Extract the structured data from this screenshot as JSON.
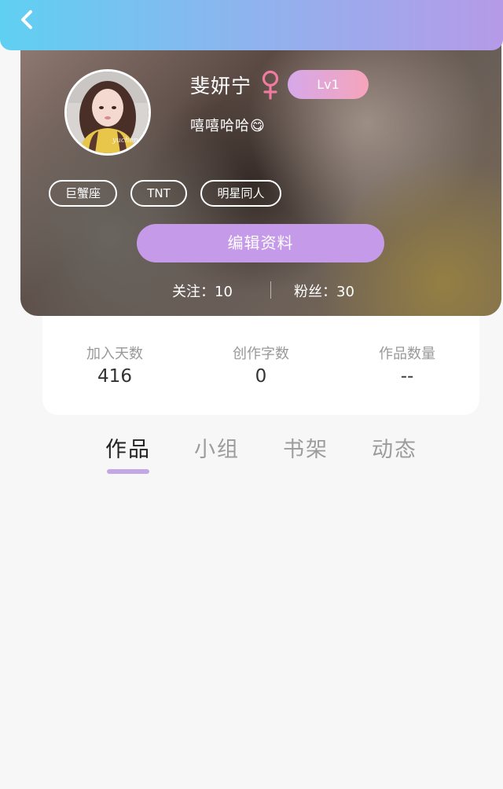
{
  "profile": {
    "name": "斐妍宁",
    "gender_icon": "female-symbol",
    "level": "Lv1",
    "bio": "嘻嘻哈哈😋",
    "tags": [
      "巨蟹座",
      "TNT",
      "明星同人"
    ],
    "edit_label": "编辑资料",
    "following": "关注：10",
    "followers": "粉丝：30"
  },
  "stats": [
    {
      "label": "加入天数",
      "value": "416"
    },
    {
      "label": "创作字数",
      "value": "0"
    },
    {
      "label": "作品数量",
      "value": "--"
    }
  ],
  "tabs": [
    {
      "label": "作品",
      "active": true
    },
    {
      "label": "小组",
      "active": false
    },
    {
      "label": "书架",
      "active": false
    },
    {
      "label": "动态",
      "active": false
    }
  ],
  "colors": {
    "header_gradient": [
      "#5fd0f2",
      "#b59ae8"
    ],
    "accent_purple": "#c59ae8",
    "gender_pink": "#f07aa0",
    "level_gradient": [
      "#d6a8ea",
      "#f5a4ba"
    ]
  }
}
